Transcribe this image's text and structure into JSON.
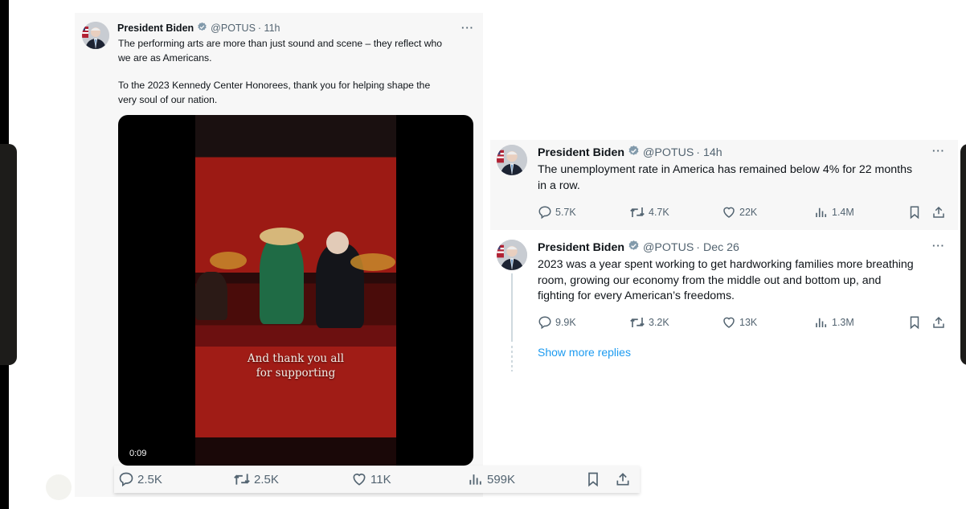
{
  "tweets": [
    {
      "author": "President Biden",
      "handle": "@POTUS",
      "time": "· 11h",
      "more": "···",
      "text_lines": [
        "The performing arts are more than just sound and scene – they reflect who",
        "we are as Americans.",
        "",
        "To the 2023 Kennedy Center Honorees, thank you for helping shape the",
        "very soul of our nation."
      ],
      "media": {
        "type": "video",
        "caption_lines": [
          "And thank you all",
          "for supporting"
        ],
        "timestamp": "0:09"
      },
      "stats": {
        "replies": "2.5K",
        "reposts": "2.5K",
        "likes": "11K",
        "views": "599K"
      }
    },
    {
      "author": "President Biden",
      "handle": "@POTUS",
      "time": "· 14h",
      "more": "···",
      "text_lines": [
        "The unemployment rate in America has remained below 4% for 22 months",
        "in a row."
      ],
      "stats": {
        "replies": "5.7K",
        "reposts": "4.7K",
        "likes": "22K",
        "views": "1.4M"
      }
    },
    {
      "author": "President Biden",
      "handle": "@POTUS",
      "time": "· Dec 26",
      "more": "···",
      "text_lines": [
        "2023 was a year spent working to get hardworking families more breathing",
        "room, growing our economy from the middle out and bottom up, and",
        "fighting for every American’s freedoms."
      ],
      "stats": {
        "replies": "9.9K",
        "reposts": "3.2K",
        "likes": "13K",
        "views": "1.3M"
      }
    }
  ],
  "thread": {
    "show_more_label": "Show more replies"
  },
  "colors": {
    "link": "#1d9bf0",
    "muted": "#536471",
    "verified": "#829aab",
    "card_bg": "#f7f7f7"
  }
}
